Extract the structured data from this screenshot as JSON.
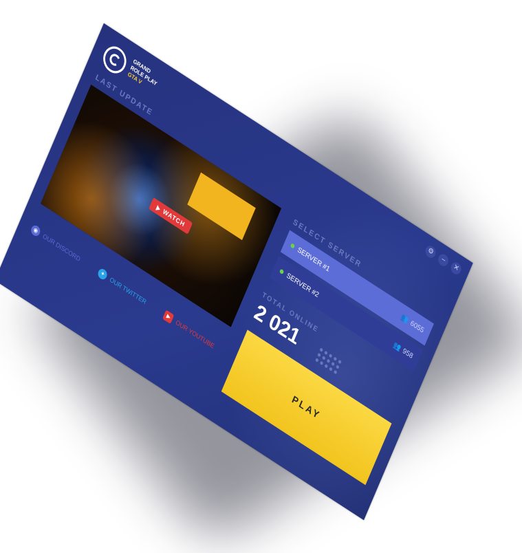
{
  "brand": {
    "line1": "GRAND",
    "line2": "ROLE PLAY",
    "line3": "GTA V"
  },
  "sections": {
    "last_update": "LAST UPDATE",
    "select_server": "SELECT SERVER",
    "total_online": "TOTAL ONLINE"
  },
  "media": {
    "watch_label": "WATCH"
  },
  "social": [
    {
      "label": "OUR DISCORD",
      "color": "#5b6bd6"
    },
    {
      "label": "OUR TWITTER",
      "color": "#2aa3e8"
    },
    {
      "label": "OUR YOUTUBE",
      "color": "#e23a3a"
    }
  ],
  "servers": [
    {
      "name": "SERVER #1",
      "count": "6055",
      "state": "active"
    },
    {
      "name": "SERVER #2",
      "count": "958",
      "state": "idle"
    }
  ],
  "total_online": "2 021",
  "play_label": "PLAY",
  "colors": {
    "accent": "#f2c41e",
    "panel": "#26327e",
    "server_active": "#5c6dd8",
    "online": "#6bd14a"
  }
}
